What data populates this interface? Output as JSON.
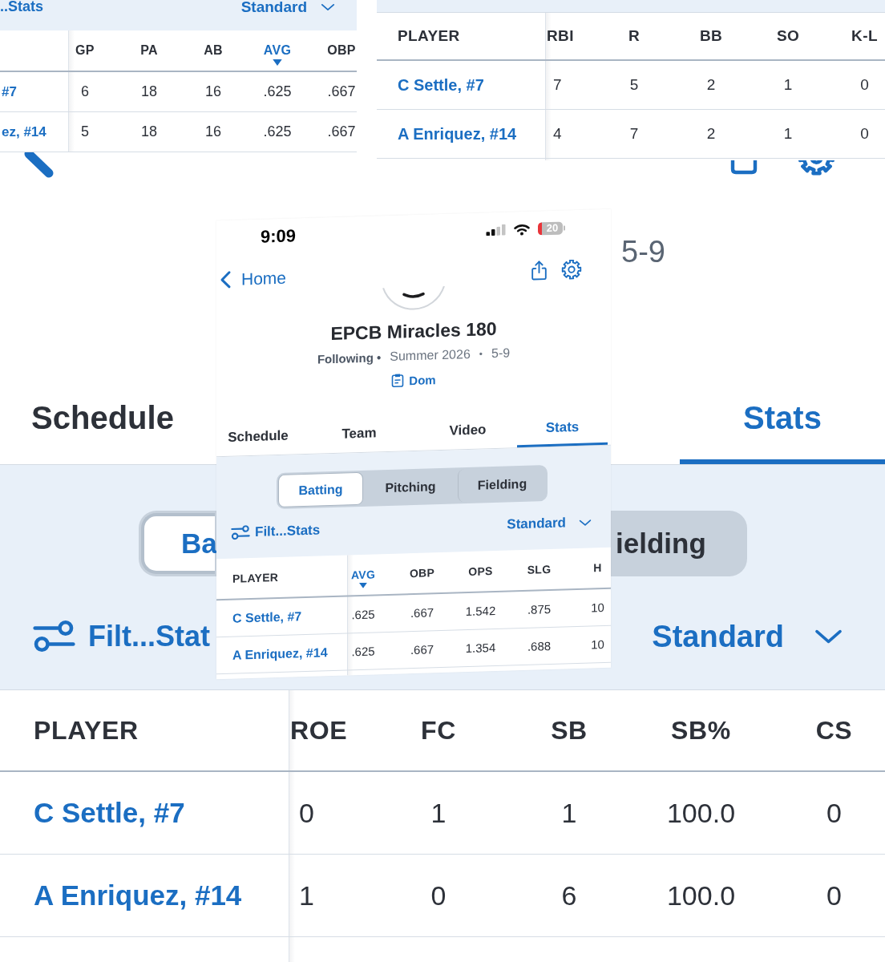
{
  "background_screen": {
    "record": "5-9",
    "tabs": [
      {
        "label": "Schedule",
        "selected": false
      },
      {
        "label": "Stats",
        "selected": true
      }
    ],
    "segments": [
      {
        "label": "Ba",
        "selected": true
      },
      {
        "label": "ielding",
        "selected": false
      }
    ],
    "filter_label": "Filt...Stat",
    "view_select": "Standard",
    "table": {
      "player_header": "PLAYER",
      "columns": [
        {
          "label": "ROE",
          "sorted": false
        },
        {
          "label": "FC",
          "sorted": false
        },
        {
          "label": "SB",
          "sorted": false
        },
        {
          "label": "SB%",
          "sorted": false
        },
        {
          "label": "CS",
          "sorted": false
        }
      ],
      "rows": [
        {
          "player": "C Settle, #7",
          "cells": [
            "0",
            "1",
            "1",
            "100.0",
            "0"
          ]
        },
        {
          "player": "A Enriquez, #14",
          "cells": [
            "1",
            "0",
            "6",
            "100.0",
            "0"
          ]
        }
      ]
    }
  },
  "top_left_clip": {
    "filter_label": "..Stats",
    "view_select": "Standard",
    "table": {
      "columns": [
        {
          "label": "GP",
          "sorted": false
        },
        {
          "label": "PA",
          "sorted": false
        },
        {
          "label": "AB",
          "sorted": false
        },
        {
          "label": "AVG",
          "sorted": true
        },
        {
          "label": "OBP",
          "sorted": false
        }
      ],
      "rows": [
        {
          "player": "#7",
          "cells": [
            "6",
            "18",
            "16",
            ".625",
            ".667"
          ]
        },
        {
          "player": "ez, #14",
          "cells": [
            "5",
            "18",
            "16",
            ".625",
            ".667"
          ]
        }
      ]
    }
  },
  "top_right_clip": {
    "table": {
      "player_header": "PLAYER",
      "columns": [
        {
          "label": "RBI",
          "sorted": false
        },
        {
          "label": "R",
          "sorted": false
        },
        {
          "label": "BB",
          "sorted": false
        },
        {
          "label": "SO",
          "sorted": false
        },
        {
          "label": "K-L",
          "sorted": false
        }
      ],
      "rows": [
        {
          "player": "C Settle, #7",
          "cells": [
            "7",
            "5",
            "2",
            "1",
            "0"
          ]
        },
        {
          "player": "A Enriquez, #14",
          "cells": [
            "4",
            "7",
            "2",
            "1",
            "0"
          ]
        }
      ]
    }
  },
  "phone_screenshot": {
    "status_bar": {
      "time": "9:09",
      "battery": "20"
    },
    "back_label": "Home",
    "team": {
      "name": "EPCB Miracles 180",
      "meta": [
        {
          "kind": "follow",
          "text": "Following •"
        },
        {
          "kind": "text",
          "text": "Summer 2026"
        },
        {
          "kind": "separator",
          "text": "•"
        },
        {
          "kind": "text",
          "text": "5-9"
        }
      ],
      "coach": "Dom"
    },
    "tabs": [
      {
        "label": "Schedule",
        "selected": false
      },
      {
        "label": "Team",
        "selected": false
      },
      {
        "label": "Video",
        "selected": false
      },
      {
        "label": "Stats",
        "selected": true
      }
    ],
    "segments": [
      {
        "label": "Batting",
        "selected": true
      },
      {
        "label": "Pitching",
        "selected": false
      },
      {
        "label": "Fielding",
        "selected": false
      }
    ],
    "filter_label": "Filt...Stats",
    "view_select": "Standard",
    "table": {
      "player_header": "PLAYER",
      "columns": [
        {
          "label": "AVG",
          "sorted": true
        },
        {
          "label": "OBP",
          "sorted": false
        },
        {
          "label": "OPS",
          "sorted": false
        },
        {
          "label": "SLG",
          "sorted": false
        },
        {
          "label": "H",
          "sorted": false
        }
      ],
      "rows": [
        {
          "player": "C Settle, #7",
          "cells": [
            ".625",
            ".667",
            "1.542",
            ".875",
            "10"
          ]
        },
        {
          "player": "A Enriquez, #14",
          "cells": [
            ".625",
            ".667",
            "1.354",
            ".688",
            "10"
          ]
        }
      ]
    }
  }
}
